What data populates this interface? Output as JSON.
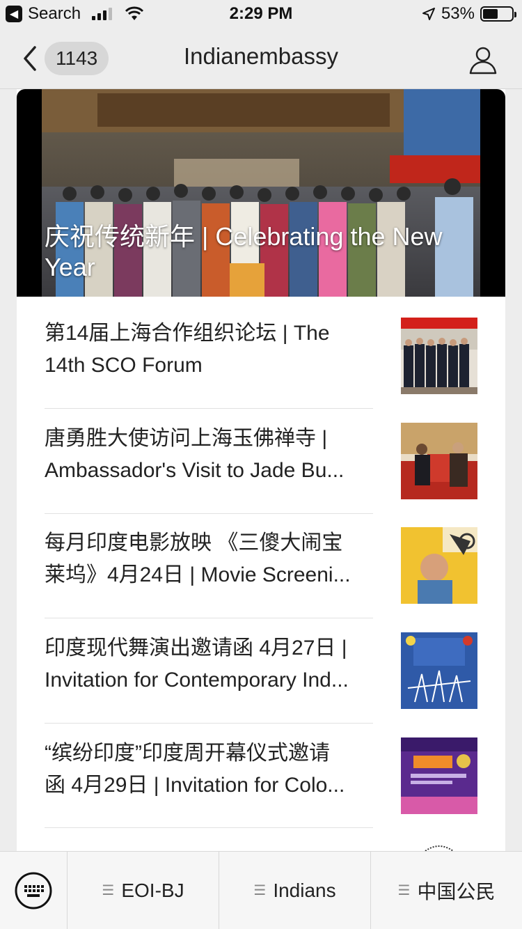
{
  "status_bar": {
    "back_app_label": "Search",
    "time": "2:29 PM",
    "battery": "53%",
    "battery_level": 0.53
  },
  "nav": {
    "unread_count": "1143",
    "title": "Indianembassy"
  },
  "hero": {
    "title": "庆祝传统新年 | Celebrating the New Year"
  },
  "articles": [
    {
      "line1": "第14届上海合作组织论坛 | The",
      "line2": "14th SCO Forum",
      "thumb": "group-photo-thumb"
    },
    {
      "line1": "唐勇胜大使访问上海玉佛禅寺 |",
      "line2": "Ambassador's Visit to Jade Bu...",
      "thumb": "meeting-thumb"
    },
    {
      "line1": "每月印度电影放映 《三傻大闹宝",
      "line2": "莱坞》4月24日 | Movie Screeni...",
      "thumb": "movie-poster-thumb"
    },
    {
      "line1": "印度现代舞演出邀请函 4月27日 |",
      "line2": "Invitation for Contemporary Ind...",
      "thumb": "dance-invitation-thumb"
    },
    {
      "line1": "“缤纷印度”印度周开幕仪式邀请",
      "line2": "函 4月29日 | Invitation for Colo...",
      "thumb": "colorful-india-thumb"
    }
  ],
  "bottom_menu": {
    "items": [
      "EOI-BJ",
      "Indians",
      "中国公民"
    ]
  }
}
